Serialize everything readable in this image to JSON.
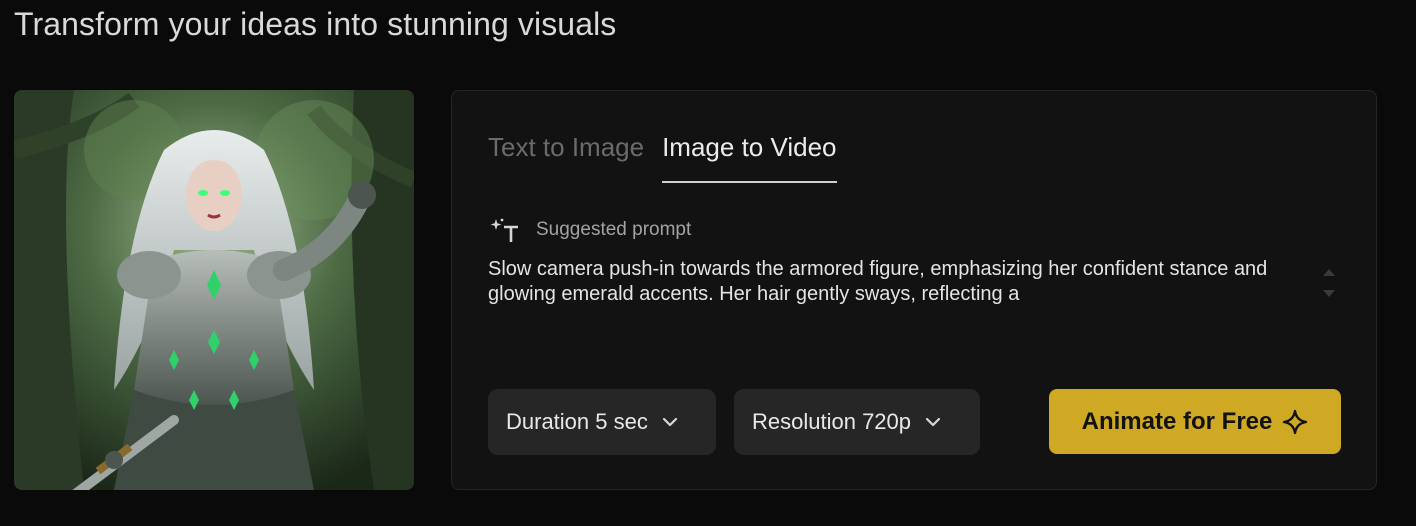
{
  "header": {
    "title": "Transform your ideas into stunning visuals"
  },
  "preview": {
    "alt": "Silver-haired warrior woman in green-accented armor in a forest"
  },
  "tabs": [
    {
      "label": "Text to Image",
      "active": false
    },
    {
      "label": "Image to Video",
      "active": true
    }
  ],
  "prompt": {
    "label": "Suggested prompt",
    "icon": "sparkle-text-icon",
    "text": "Slow camera push-in towards the armored figure, emphasizing her confident stance and glowing emerald accents. Her hair gently sways, reflecting a"
  },
  "controls": {
    "duration_label": "Duration 5 sec",
    "resolution_label": "Resolution 720p",
    "animate_label": "Animate for Free",
    "animate_icon": "sparkle-icon",
    "dropdown_icon": "chevron-down-icon"
  },
  "colors": {
    "background": "#0a0a0a",
    "panel": "#121212",
    "button_secondary": "#262626",
    "accent": "#cfa923"
  }
}
